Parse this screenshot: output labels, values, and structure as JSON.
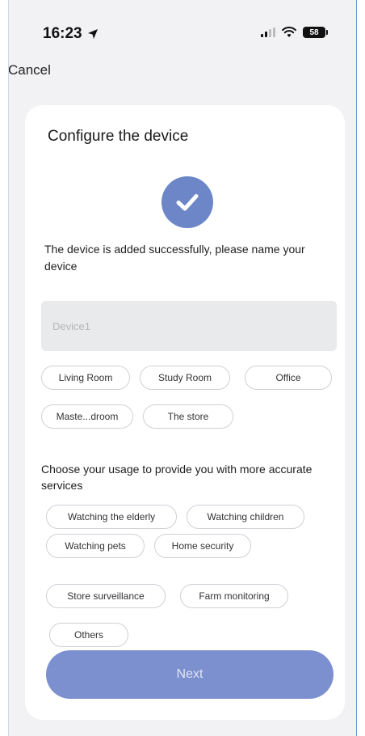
{
  "status_bar": {
    "time": "16:23",
    "battery": "58"
  },
  "header": {
    "cancel_label": "Cancel"
  },
  "card": {
    "title": "Configure the device",
    "success_message": "The device is added successfully, please name your device",
    "name_input": {
      "value": "",
      "placeholder": "Device1"
    },
    "room_chips": [
      "Living Room",
      "Study Room",
      "Office",
      "Maste...droom",
      "The store"
    ],
    "usage_prompt": "Choose your usage to provide you with more accurate services",
    "usage_chips": [
      "Watching the elderly",
      "Watching children",
      "Watching pets",
      "Home security",
      "Store surveillance",
      "Farm monitoring",
      "Others"
    ],
    "next_label": "Next"
  },
  "colors": {
    "accent": "#6c86c8",
    "button": "#7c90cf",
    "background": "#f2f2f4"
  }
}
